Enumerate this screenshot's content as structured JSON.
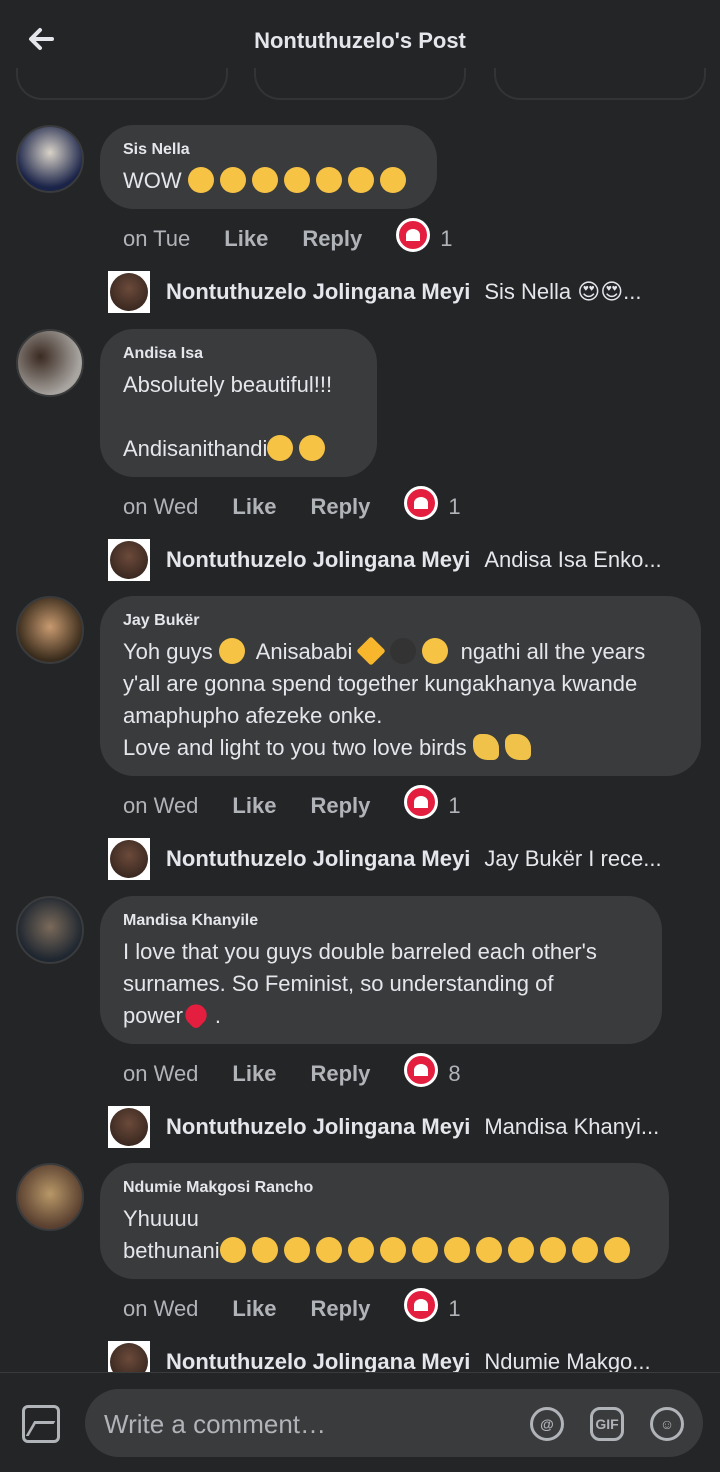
{
  "header": {
    "title": "Nontuthuzelo's Post"
  },
  "comments": [
    {
      "name": "Sis Nella",
      "text": "WOW",
      "time": "on Tue",
      "like": "Like",
      "reply": "Reply",
      "reactions": "1",
      "reply_preview": {
        "name": "Nontuthuzelo Jolingana Meyi",
        "text": "Sis Nella 😍😍..."
      }
    },
    {
      "name": "Andisa Isa",
      "text": "Absolutely beautiful!!!\n\nAndisanithandi",
      "time": "on Wed",
      "like": "Like",
      "reply": "Reply",
      "reactions": "1",
      "reply_preview": {
        "name": "Nontuthuzelo Jolingana Meyi",
        "text": "Andisa Isa Enko..."
      }
    },
    {
      "name": "Jay Bukër",
      "text_parts": [
        "Yoh guys ",
        " Anisababi ",
        " ngathi all the years",
        "y'all are gonna spend together kungakhanya kwande",
        "amaphupho afezeke onke.",
        "Love and light to you two love birds "
      ],
      "time": "on Wed",
      "like": "Like",
      "reply": "Reply",
      "reactions": "1",
      "reply_preview": {
        "name": "Nontuthuzelo Jolingana Meyi",
        "text": "Jay Bukër I rece..."
      }
    },
    {
      "name": "Mandisa Khanyile",
      "text_parts": [
        "I love that you guys double barreled each other's",
        "surnames. So Feminist, so understanding of",
        "power",
        "."
      ],
      "time": "on Wed",
      "like": "Like",
      "reply": "Reply",
      "reactions": "8",
      "reply_preview": {
        "name": "Nontuthuzelo Jolingana Meyi",
        "text": "Mandisa Khanyi..."
      }
    },
    {
      "name": "Ndumie Makgosi Rancho",
      "text_parts": [
        "Yhuuuu",
        "bethunani"
      ],
      "time": "on Wed",
      "like": "Like",
      "reply": "Reply",
      "reactions": "1",
      "reply_preview": {
        "name": "Nontuthuzelo Jolingana Meyi",
        "text": "Ndumie Makgo..."
      }
    }
  ],
  "composer": {
    "placeholder": "Write a comment…",
    "gif_label": "GIF"
  },
  "colors": {
    "background": "#242526",
    "bubble": "#3a3b3c",
    "text": "#e4e6eb",
    "muted": "#b0b3b8",
    "love": "#e41e3f"
  },
  "icons": [
    "back-arrow-icon",
    "heart-reaction-icon",
    "photo-icon",
    "at-icon",
    "gif-icon",
    "emoji-icon"
  ]
}
